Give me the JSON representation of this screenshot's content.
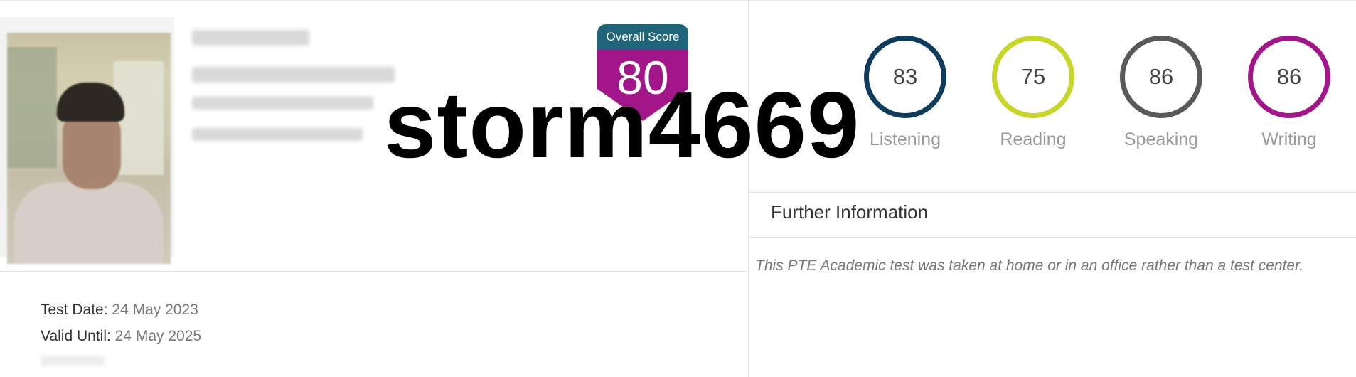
{
  "overall": {
    "caption": "Overall Score",
    "score": "80",
    "cap_color": "#1f6478",
    "shield_color": "#a3168a"
  },
  "skills": [
    {
      "label": "Listening",
      "score": "83",
      "color": "#0f3b5c"
    },
    {
      "label": "Reading",
      "score": "75",
      "color": "#c8d62a"
    },
    {
      "label": "Speaking",
      "score": "86",
      "color": "#595959"
    },
    {
      "label": "Writing",
      "score": "86",
      "color": "#a3168a"
    }
  ],
  "watermark": "storm4669",
  "further_info": {
    "title": "Further Information",
    "text": "This PTE Academic test was taken at home or in an office rather than a test center."
  },
  "test_info": {
    "test_date_label": "Test Date:",
    "test_date": "24 May 2023",
    "valid_until_label": "Valid Until:",
    "valid_until": "24 May 2025"
  },
  "icons": {
    "photo": "candidate-photo"
  }
}
